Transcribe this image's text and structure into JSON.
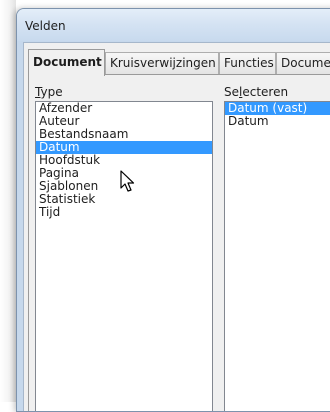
{
  "window": {
    "title": "Velden"
  },
  "tabs": [
    {
      "label": "Document",
      "active": true
    },
    {
      "label": "Kruisverwijzingen",
      "active": false
    },
    {
      "label": "Functies",
      "active": false
    },
    {
      "label": "Docume",
      "active": false
    }
  ],
  "type_section": {
    "label_pre": "",
    "label_mnemonic": "T",
    "label_post": "ype",
    "items": [
      "Afzender",
      "Auteur",
      "Bestandsnaam",
      "Datum",
      "Hoofdstuk",
      "Pagina",
      "Sjablonen",
      "Statistiek",
      "Tijd"
    ],
    "selected": "Datum"
  },
  "select_section": {
    "label_pre": "Se",
    "label_mnemonic": "l",
    "label_post": "ecteren",
    "items": [
      "Datum (vast)",
      "Datum"
    ],
    "selected": "Datum (vast)"
  },
  "colors": {
    "selection": "#3399ff",
    "dialog_bg": "#f0f0f0",
    "frame": "#c6d8ec"
  },
  "icons": {
    "pointer": "arrow-cursor-icon"
  }
}
